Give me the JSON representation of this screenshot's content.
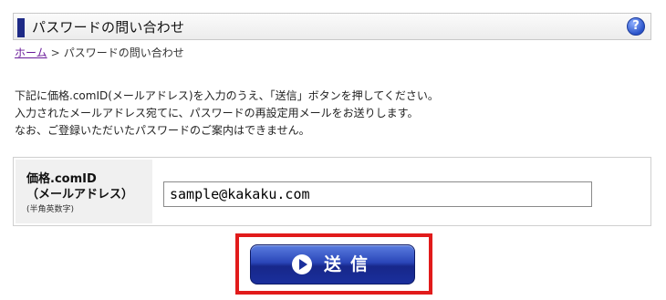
{
  "header": {
    "title": "パスワードの問い合わせ",
    "help_icon": "question-circle-icon",
    "help_glyph": "?"
  },
  "breadcrumb": {
    "home_label": "ホーム",
    "separator": ">",
    "current": "パスワードの問い合わせ"
  },
  "instructions": {
    "lines": [
      "下記に価格.comID(メールアドレス)を入力のうえ、「送信」ボタンを押してください。",
      "入力されたメールアドレス宛てに、パスワードの再設定用メールをお送りします。",
      "なお、ご登録いただいたパスワードのご案内はできません。"
    ]
  },
  "form": {
    "label_line1": "価格.comID",
    "label_line2": "（メールアドレス）",
    "label_note": "(半角英数字)",
    "email_value": "sample@kakaku.com"
  },
  "submit": {
    "label": "送信",
    "icon": "play-circle-icon"
  },
  "colors": {
    "accent": "#1e2a86",
    "button": "#1a2f9c",
    "highlight": "#e11b1b",
    "link": "#6a1b9a"
  }
}
